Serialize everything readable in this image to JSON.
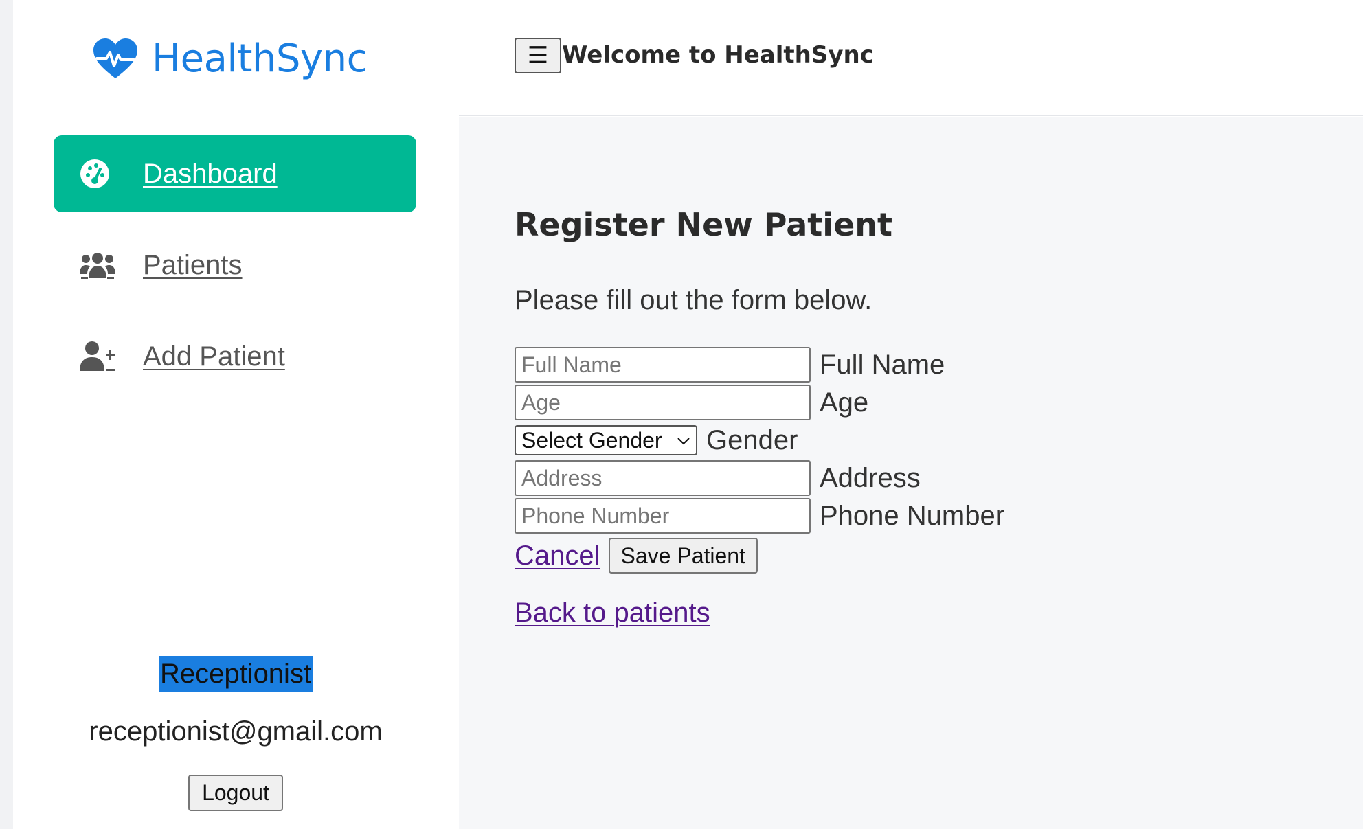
{
  "brand": {
    "name": "HealthSync",
    "icon": "heart-pulse-icon",
    "color": "#1a7ee0"
  },
  "sidebar": {
    "items": [
      {
        "label": "Dashboard",
        "icon": "gauge-icon",
        "active": true
      },
      {
        "label": "Patients",
        "icon": "users-icon",
        "active": false
      },
      {
        "label": "Add Patient",
        "icon": "user-plus-icon",
        "active": false
      }
    ],
    "active_color": "#00b894"
  },
  "user": {
    "role": "Receptionist",
    "email": "receptionist@gmail.com",
    "logout_label": "Logout"
  },
  "header": {
    "menu_icon": "☰",
    "welcome": "Welcome to HealthSync"
  },
  "main": {
    "title": "Register New Patient",
    "subtitle": "Please fill out the form below.",
    "form": {
      "full_name": {
        "placeholder": "Full Name",
        "label": "Full Name",
        "value": ""
      },
      "age": {
        "placeholder": "Age",
        "label": "Age",
        "value": ""
      },
      "gender": {
        "selected": "Select Gender",
        "label": "Gender"
      },
      "address": {
        "placeholder": "Address",
        "label": "Address",
        "value": ""
      },
      "phone": {
        "placeholder": "Phone Number",
        "label": "Phone Number",
        "value": ""
      }
    },
    "cancel_label": "Cancel",
    "save_label": "Save Patient",
    "back_label": "Back to patients"
  }
}
